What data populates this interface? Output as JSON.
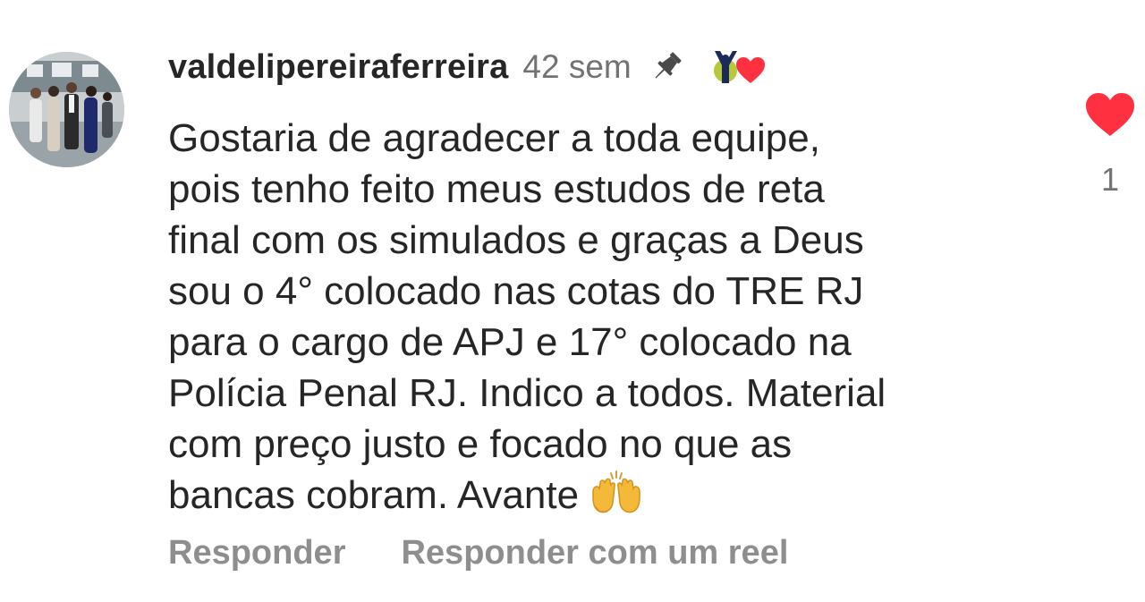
{
  "comment": {
    "username": "valdelipereiraferreira",
    "time": "42 sem",
    "pin_icon": "pin-icon",
    "creator_like_icon": "creator-heart-badge",
    "text": "Gostaria de agradecer a toda equipe,\npois tenho feito meus estudos de reta\nfinal com os simulados e graças a Deus\nsou o  4° colocado nas cotas do TRE RJ\npara o cargo de APJ e 17° colocado na\nPolícia Penal RJ. Indico a todos. Material\ncom preço justo e focado no que as\nbancas cobram. Avante",
    "text_emoji": "raising-hands-emoji",
    "like_count": "1",
    "liked": true
  },
  "actions": {
    "reply_label": "Responder",
    "reply_reel_label": "Responder com um reel"
  },
  "colors": {
    "like_red": "#ff3040",
    "text": "#262626",
    "muted": "#8e8e8e"
  }
}
